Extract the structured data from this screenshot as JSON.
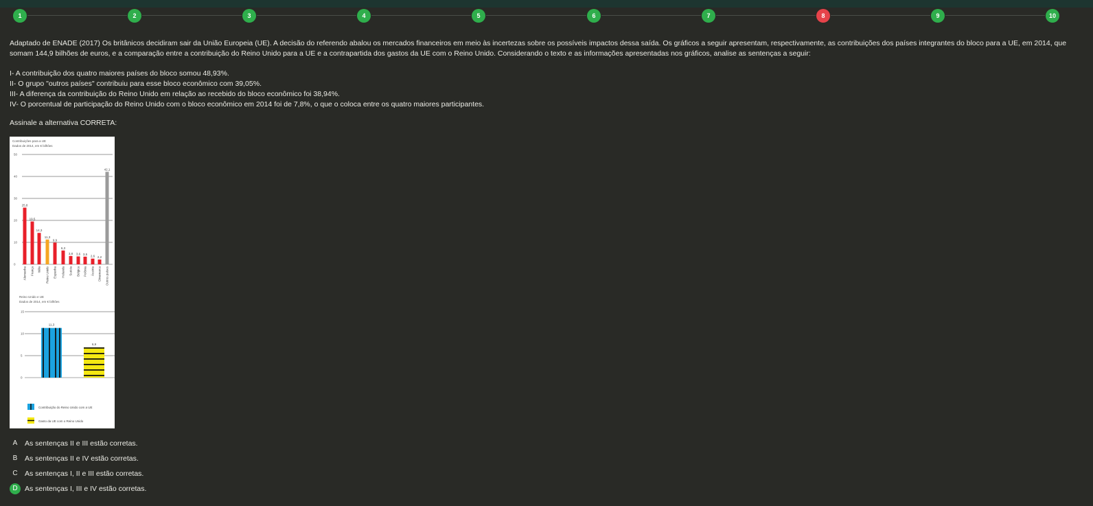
{
  "steps": [
    {
      "label": "1",
      "status": "correct"
    },
    {
      "label": "2",
      "status": "correct"
    },
    {
      "label": "3",
      "status": "correct"
    },
    {
      "label": "4",
      "status": "correct"
    },
    {
      "label": "5",
      "status": "correct"
    },
    {
      "label": "6",
      "status": "correct"
    },
    {
      "label": "7",
      "status": "correct"
    },
    {
      "label": "8",
      "status": "wrong"
    },
    {
      "label": "9",
      "status": "correct"
    },
    {
      "label": "10",
      "status": "correct"
    }
  ],
  "colors": {
    "correct": "#2fae4c",
    "wrong": "#e6434a",
    "background": "#292a26",
    "topbar": "#1d3530"
  },
  "question": {
    "intro": "Adaptado de ENADE (2017) Os britânicos decidiram sair da União Europeia (UE). A decisão do referendo abalou os mercados financeiros em meio às incertezas sobre os possíveis impactos dessa saída. Os gráficos a seguir apresentam, respectivamente, as contribuições dos países integrantes do bloco para a UE, em 2014, que somam 144,9 bilhões de euros, e a comparação entre a contribuição do Reino Unido para a UE e a contrapartida dos gastos da UE com o Reino Unido. Considerando o texto e as informações apresentadas nos gráficos, analise as sentenças a seguir:",
    "statements": [
      "I- A contribuição dos quatro maiores países do bloco somou 48,93%.",
      "II- O grupo \"outros países\" contribuiu para esse bloco econômico com 39,05%.",
      "III- A diferença da contribuição do Reino Unido em relação ao recebido do bloco econômico foi 38,94%.",
      "IV- O porcentual de participação do Reino Unido com o bloco econômico em 2014 foi de 7,8%, o que o coloca entre os quatro maiores participantes."
    ],
    "prompt": "Assinale a alternativa CORRETA:"
  },
  "chart_data": [
    {
      "type": "bar",
      "title": "Contribuições para a UE",
      "subtitle": "Dados de 2014, em € bilhões",
      "categories": [
        "Alemanha",
        "França",
        "Itália",
        "Reino Unido",
        "Espanha",
        "Holanda",
        "Suécia",
        "Bélgica",
        "Polônia",
        "Áustria",
        "Dinamarca",
        "Outros países"
      ],
      "values": [
        25.8,
        19.5,
        14.3,
        11.3,
        9.9,
        6.3,
        3.8,
        3.6,
        3.5,
        2.6,
        2.2,
        42.1
      ],
      "value_labels": [
        "25,8",
        "19,5",
        "14,3",
        "11,3",
        "9,9",
        "6,3",
        "3,8",
        "3,6",
        "3,5",
        "2,6",
        "2,2",
        "42,1"
      ],
      "bar_colors": [
        "#e8202a",
        "#e8202a",
        "#e8202a",
        "#f5a623",
        "#e8202a",
        "#e8202a",
        "#e8202a",
        "#e8202a",
        "#e8202a",
        "#e8202a",
        "#e8202a",
        "#9b9b9b"
      ],
      "yticks": [
        0,
        10,
        20,
        30,
        40,
        50
      ],
      "ylim": [
        0,
        50
      ],
      "grid": true
    },
    {
      "type": "bar",
      "title": "Reino Unido e UE",
      "subtitle": "Dados de 2014, em € bilhões",
      "categories": [
        "Contribuição do Reino Unido com a UE",
        "Gasto da UE com o Reino Unido"
      ],
      "values": [
        11.3,
        6.9
      ],
      "value_labels": [
        "11,3",
        "6,9"
      ],
      "bar_colors": [
        "#1ba3e0",
        "#f4e812"
      ],
      "yticks": [
        0,
        5,
        10,
        15
      ],
      "ylim": [
        0,
        15
      ],
      "legend": [
        "Contribuição do Reino Unido com a UE",
        "Gasto da UE com o Reino Unido"
      ],
      "legend_position": "bottom",
      "grid": true
    }
  ],
  "options": [
    {
      "letter": "A",
      "text": "As sentenças II e III estão corretas.",
      "selected": false
    },
    {
      "letter": "B",
      "text": "As sentenças II e IV estão corretas.",
      "selected": false
    },
    {
      "letter": "C",
      "text": "As sentenças I, II e III estão corretas.",
      "selected": false
    },
    {
      "letter": "D",
      "text": "As sentenças I, III e IV estão corretas.",
      "selected": true
    }
  ]
}
